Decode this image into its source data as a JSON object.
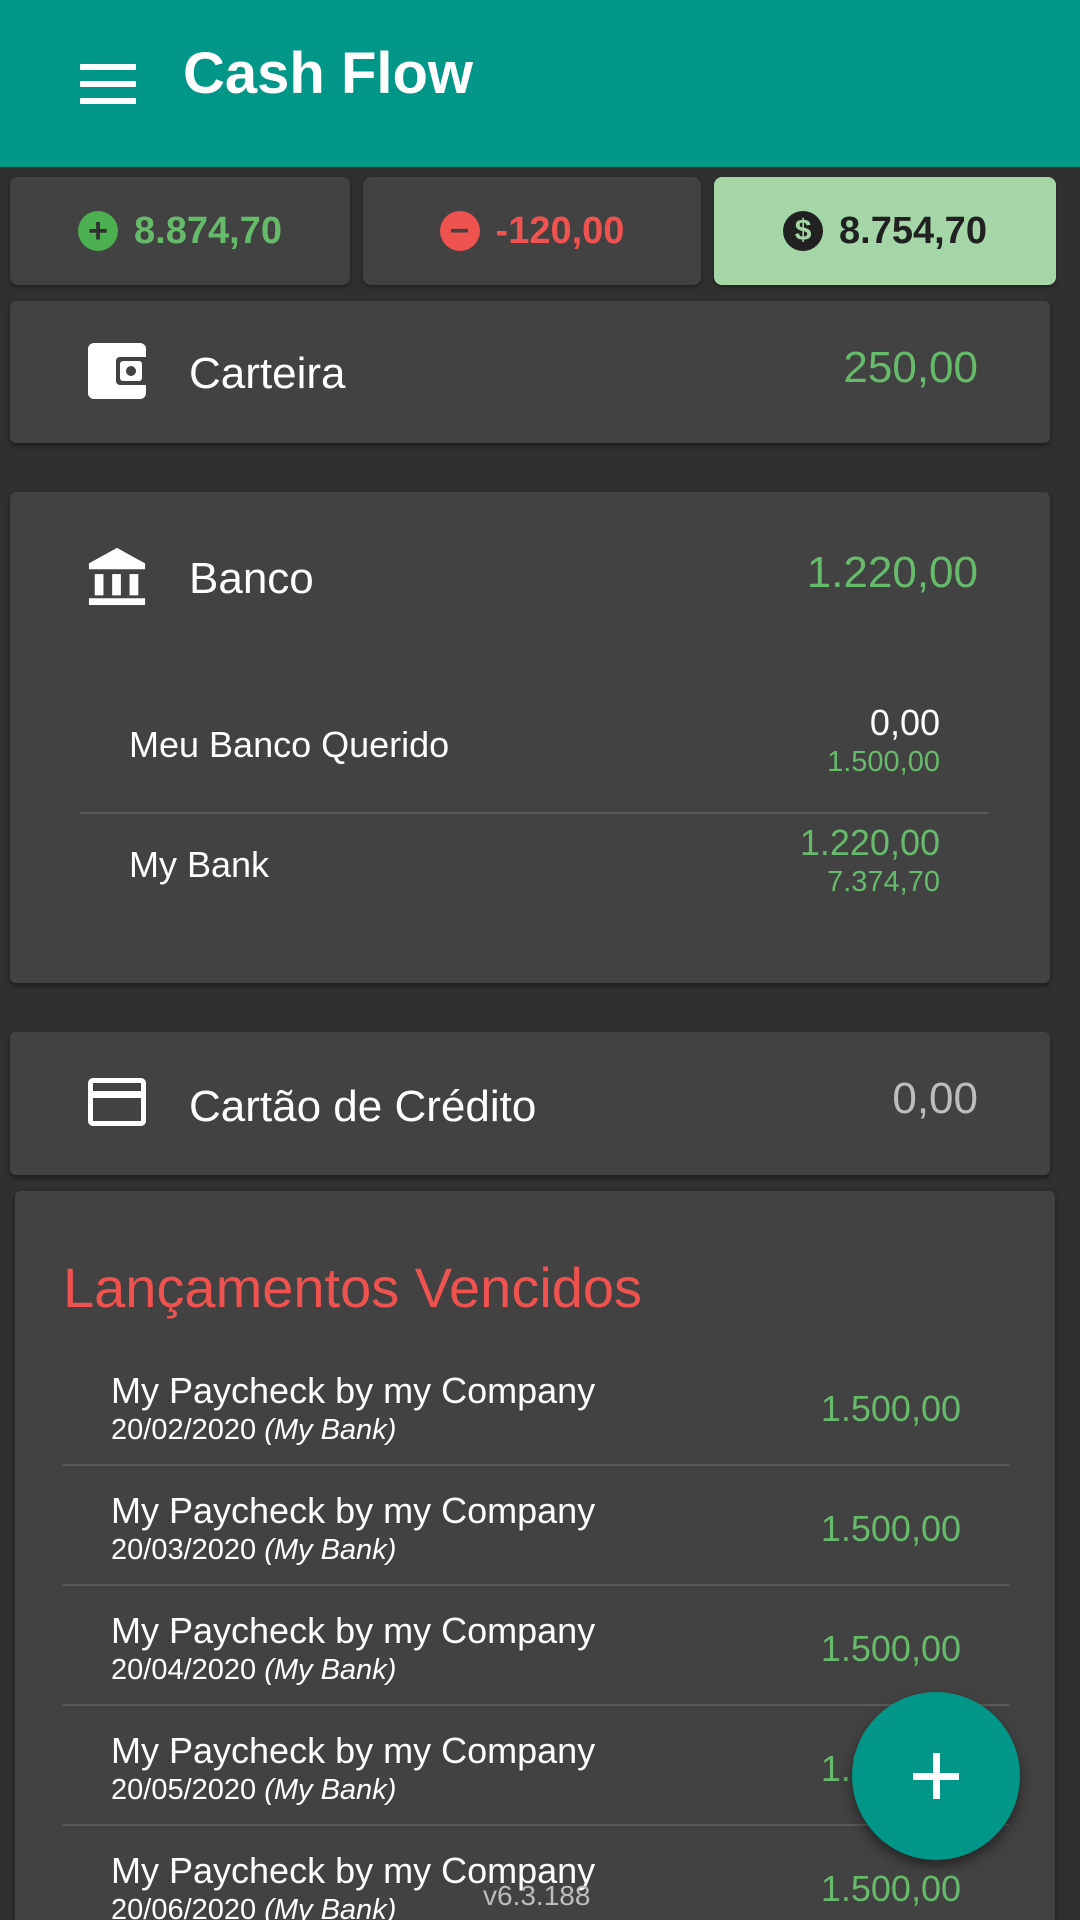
{
  "app": {
    "title": "Cash Flow"
  },
  "totals": {
    "income": "8.874,70",
    "expense": "-120,00",
    "balance": "8.754,70",
    "income_color": "#66bb6a",
    "expense_color": "#ef5350",
    "balance_bg": "#a5d6a7"
  },
  "accounts": {
    "wallet": {
      "name": "Carteira",
      "value": "250,00",
      "icon": "wallet-icon"
    },
    "bank": {
      "name": "Banco",
      "value": "1.220,00",
      "icon": "bank-icon",
      "items": [
        {
          "name": "Meu Banco Querido",
          "value": "0,00",
          "secondary": "1.500,00"
        },
        {
          "name": "My Bank",
          "value": "1.220,00",
          "secondary": "7.374,70"
        }
      ]
    },
    "credit": {
      "name": "Cartão de Crédito",
      "value": "0,00",
      "icon": "credit-card-icon"
    }
  },
  "overdue": {
    "title": "Lançamentos Vencidos",
    "items": [
      {
        "name": "My Paycheck by my Company",
        "date": "20/02/2020",
        "account": "(My Bank)",
        "value": "1.500,00"
      },
      {
        "name": "My Paycheck by my Company",
        "date": "20/03/2020",
        "account": "(My Bank)",
        "value": "1.500,00"
      },
      {
        "name": "My Paycheck by my Company",
        "date": "20/04/2020",
        "account": "(My Bank)",
        "value": "1.500,00"
      },
      {
        "name": "My Paycheck by my Company",
        "date": "20/05/2020",
        "account": "(My Bank)",
        "value": "1.500,00"
      },
      {
        "name": "My Paycheck by my Company",
        "date": "20/06/2020",
        "account": "(My Bank)",
        "value": "1.500,00"
      }
    ]
  },
  "fab": {
    "icon": "plus-icon"
  },
  "version": "v6.3.188",
  "theme": {
    "primary": "#009688",
    "background": "#303030",
    "card": "#424242"
  }
}
